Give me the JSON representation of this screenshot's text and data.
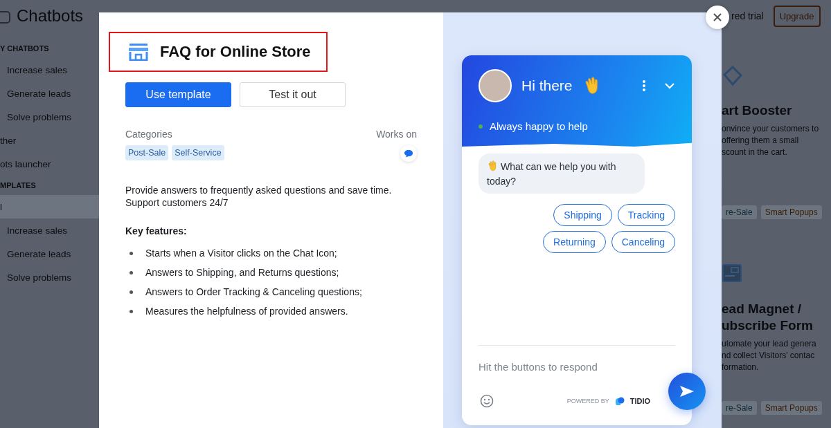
{
  "background": {
    "app_title": "Chatbots",
    "sidebar": [
      {
        "kind": "heading",
        "label": "Y CHATBOTS",
        "selected": false
      },
      {
        "kind": "item",
        "label": "Increase sales",
        "selected": false
      },
      {
        "kind": "item",
        "label": "Generate leads",
        "selected": false
      },
      {
        "kind": "item",
        "label": "Solve problems",
        "selected": false
      },
      {
        "kind": "link",
        "label": "ther",
        "selected": false
      },
      {
        "kind": "link",
        "label": "ots launcher",
        "selected": false
      },
      {
        "kind": "heading",
        "label": "MPLATES",
        "selected": false
      },
      {
        "kind": "link",
        "label": "l",
        "selected": true
      },
      {
        "kind": "item",
        "label": "Increase sales",
        "selected": false
      },
      {
        "kind": "item",
        "label": "Generate leads",
        "selected": false
      },
      {
        "kind": "item",
        "label": "Solve problems",
        "selected": false
      }
    ],
    "header": {
      "trial_text": "red trial",
      "upgrade_button": "Upgrade"
    },
    "cards": [
      {
        "kind": "tag",
        "title_lines": [
          "art Booster"
        ],
        "description_lines": [
          "onvince your customers to",
          "offering them a small",
          "scount in the cart."
        ],
        "tags": [
          {
            "label": "re-Sale",
            "color": "#0f2a36"
          },
          {
            "label": "Smart Popups",
            "color": "#3a1e06"
          }
        ]
      },
      {
        "kind": "form",
        "title_lines": [
          "ead Magnet /",
          "ubscribe Form"
        ],
        "description_lines": [
          "utomate your lead genera",
          "nd collect Visitors' contac",
          "formation."
        ],
        "tags": [
          {
            "label": "re-Sale",
            "color": "#0f2a36"
          },
          {
            "label": "Smart Popups",
            "color": "#3a1e06"
          }
        ]
      }
    ]
  },
  "modal": {
    "title": "FAQ for Online Store",
    "buttons": [
      {
        "kind": "primary",
        "label": "Use template"
      },
      {
        "kind": "secondary",
        "label": "Test it out"
      }
    ],
    "categories_label": "Categories",
    "categories": [
      "Post-Sale",
      "Self-Service"
    ],
    "works_on_label": "Works on",
    "description_lines": [
      "Provide answers to frequently asked questions and save time.",
      "Support customers 24/7"
    ],
    "features_title": "Key features:",
    "features": [
      "Starts when a Visitor clicks on the Chat Icon;",
      "Answers to Shipping, and Returns questions;",
      "Answers to Order Tracking & Canceling questions;",
      "Measures the helpfulness of provided answers."
    ],
    "preview": {
      "greeting": "Hi there",
      "status": "Always happy to help",
      "online": true,
      "message": "What can we help you with today?",
      "quick_replies": [
        "Shipping",
        "Tracking",
        "Returning",
        "Canceling"
      ],
      "input_placeholder": "Hit the buttons to respond",
      "powered_by": "POWERED BY",
      "brand": "TIDIO"
    }
  }
}
